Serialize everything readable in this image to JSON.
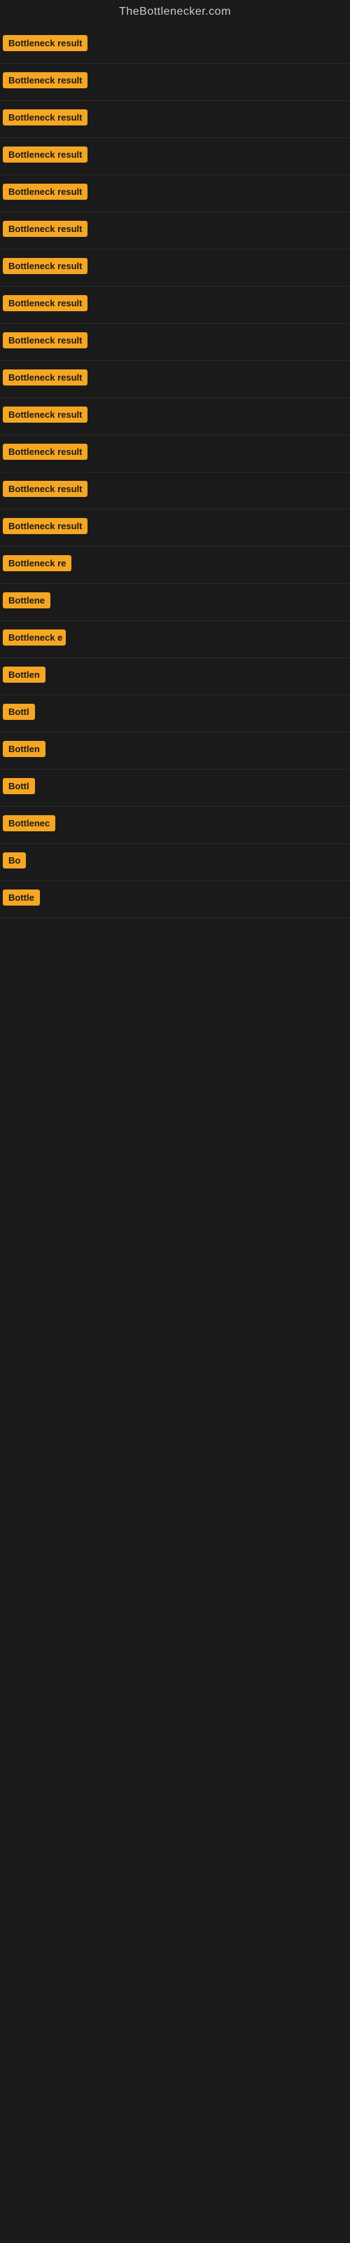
{
  "site": {
    "title": "TheBottlenecker.com"
  },
  "badges": {
    "label": "Bottleneck result",
    "color": "#f5a623"
  },
  "rows": [
    {
      "id": 1,
      "text": "Bottleneck result",
      "width": 130
    },
    {
      "id": 2,
      "text": "Bottleneck result",
      "width": 130
    },
    {
      "id": 3,
      "text": "Bottleneck result",
      "width": 130
    },
    {
      "id": 4,
      "text": "Bottleneck result",
      "width": 130
    },
    {
      "id": 5,
      "text": "Bottleneck result",
      "width": 130
    },
    {
      "id": 6,
      "text": "Bottleneck result",
      "width": 130
    },
    {
      "id": 7,
      "text": "Bottleneck result",
      "width": 130
    },
    {
      "id": 8,
      "text": "Bottleneck result",
      "width": 130
    },
    {
      "id": 9,
      "text": "Bottleneck result",
      "width": 130
    },
    {
      "id": 10,
      "text": "Bottleneck result",
      "width": 130
    },
    {
      "id": 11,
      "text": "Bottleneck result",
      "width": 130
    },
    {
      "id": 12,
      "text": "Bottleneck result",
      "width": 130
    },
    {
      "id": 13,
      "text": "Bottleneck result",
      "width": 130
    },
    {
      "id": 14,
      "text": "Bottleneck result",
      "width": 130
    },
    {
      "id": 15,
      "text": "Bottleneck re",
      "width": 105
    },
    {
      "id": 16,
      "text": "Bottlene",
      "width": 78
    },
    {
      "id": 17,
      "text": "Bottleneck e",
      "width": 90
    },
    {
      "id": 18,
      "text": "Bottlen",
      "width": 68
    },
    {
      "id": 19,
      "text": "Bottl",
      "width": 58
    },
    {
      "id": 20,
      "text": "Bottlen",
      "width": 68
    },
    {
      "id": 21,
      "text": "Bottl",
      "width": 55
    },
    {
      "id": 22,
      "text": "Bottlenec",
      "width": 80
    },
    {
      "id": 23,
      "text": "Bo",
      "width": 35
    },
    {
      "id": 24,
      "text": "Bottle",
      "width": 60
    }
  ]
}
